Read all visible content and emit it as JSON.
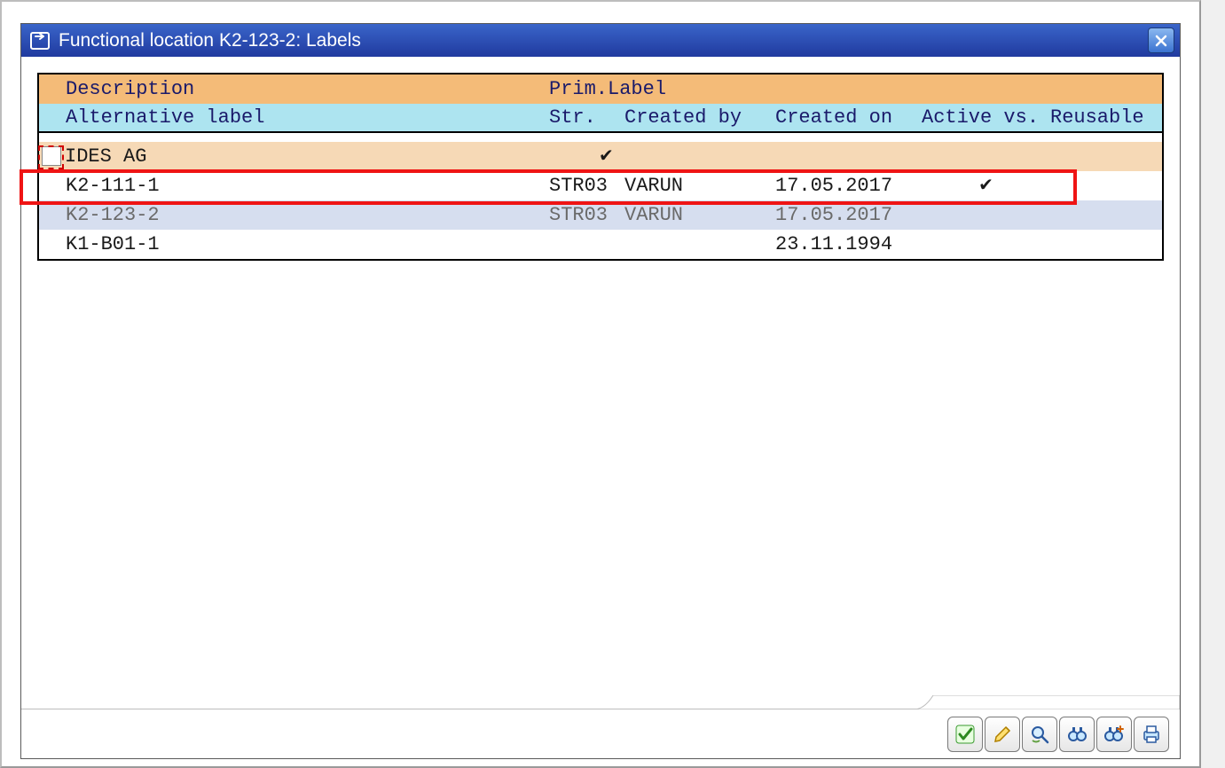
{
  "window": {
    "title": "Functional location K2-123-2: Labels"
  },
  "headers": {
    "row1": {
      "description": "Description",
      "prim_label": "Prim.Label"
    },
    "row2": {
      "alt_label": "Alternative label",
      "str": "Str.",
      "created_by": "Created by",
      "created_on": "Created on",
      "active_vs": "Active vs.",
      "reusable": "Reusable"
    }
  },
  "rows": [
    {
      "desc": "IDES AG",
      "str": "",
      "created_by": "",
      "created_on": "",
      "active": "",
      "checkbox": true,
      "prim_check": true,
      "style": "ides"
    },
    {
      "desc": "K2-111-1",
      "str": "STR03",
      "created_by": "VARUN",
      "created_on": "17.05.2017",
      "active": "✔",
      "style": "white",
      "highlight": true
    },
    {
      "desc": "K2-123-2",
      "str": "STR03",
      "created_by": "VARUN",
      "created_on": "17.05.2017",
      "active": "",
      "style": "sel"
    },
    {
      "desc": "K1-B01-1",
      "str": "",
      "created_by": "",
      "created_on": "23.11.1994",
      "active": "",
      "style": "white"
    }
  ],
  "icons": {
    "ok": "ok",
    "edit": "edit",
    "find": "find-replace",
    "binoc": "binoculars",
    "binoc_plus": "binoculars-plus",
    "print": "print"
  }
}
